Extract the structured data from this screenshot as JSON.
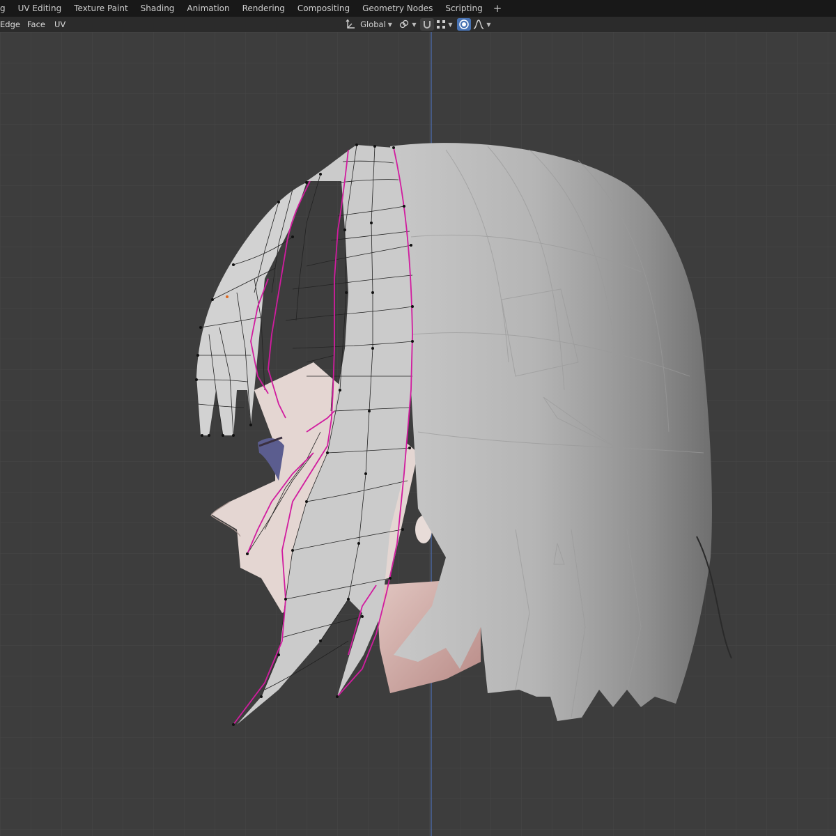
{
  "workspace_tabs": [
    "g",
    "UV Editing",
    "Texture Paint",
    "Shading",
    "Animation",
    "Rendering",
    "Compositing",
    "Geometry Nodes",
    "Scripting"
  ],
  "add_workspace_label": "+",
  "header": {
    "menus": [
      "Edge",
      "Face",
      "UV"
    ],
    "transform_orientation": "Global",
    "icons": {
      "orientation": "transform-axes-icon",
      "pivot": "link-pivot-icon",
      "snap": "snap-magnet-icon",
      "snap_target": "snap-grid-icon",
      "proportional": "proportional-editing-icon",
      "falloff": "falloff-curve-icon"
    }
  },
  "viewport": {
    "description_icons": [
      "mesh-edit-icon"
    ],
    "colors": {
      "background": "#3d3d3d",
      "grid": "#474747",
      "hair": "#a9a9a9",
      "skin": "#d3a9a4",
      "seam": "#d11c9f",
      "edge": "#222222",
      "vertex": "#111111",
      "axis": "#4d6fb3"
    }
  }
}
